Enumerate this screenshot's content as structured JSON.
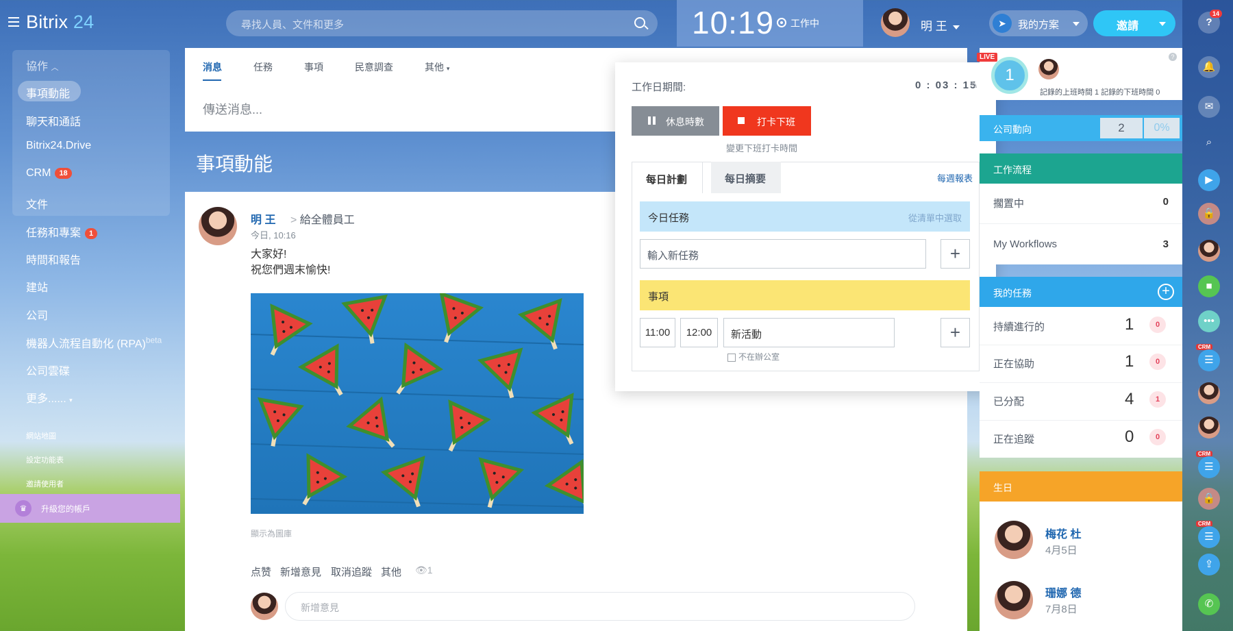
{
  "header": {
    "logo_main": "Bitrix",
    "logo_num": "24",
    "search_placeholder": "尋找人員、文件和更多",
    "clock": "10:19",
    "status": "工作中",
    "user_name": "明 王",
    "plan_label": "我的方案",
    "invite_label": "邀請"
  },
  "left_menu": {
    "section": "協作",
    "items": [
      {
        "label": "事項動能"
      },
      {
        "label": "聊天和通話"
      },
      {
        "label": "Bitrix24.Drive"
      },
      {
        "label": "CRM",
        "badge": "18"
      },
      {
        "label": "文件"
      },
      {
        "label": "任務和專案",
        "badge": "1"
      },
      {
        "label": "時間和報告"
      },
      {
        "label": "建站"
      },
      {
        "label": "公司"
      },
      {
        "label": "機器人流程自動化 (RPA)",
        "sup": "beta"
      },
      {
        "label": "公司雲碟"
      },
      {
        "label": "更多......"
      }
    ],
    "links": [
      "網站地圖",
      "設定功能表",
      "邀請使用者"
    ],
    "upgrade": "升級您的帳戶"
  },
  "feed": {
    "tabs": [
      "消息",
      "任務",
      "事項",
      "民意調查",
      "其他"
    ],
    "send_placeholder": "傳送消息...",
    "title": "事項動能",
    "post": {
      "author": "明 王",
      "to": "給全體員工",
      "time": "今日, 10:16",
      "line1": "大家好!",
      "line2": "祝您們週末愉快!",
      "show_gallery": "顯示為圖庫",
      "actions": [
        "点赞",
        "新增意見",
        "取消追蹤",
        "其他"
      ],
      "views": "1",
      "comment_placeholder": "新增意見"
    }
  },
  "popup": {
    "work_label": "工作日期間:",
    "work_time": "0 : 03 : 15",
    "pause": "休息時數",
    "clock_out": "打卡下班",
    "change_time": "變更下班打卡時間",
    "tab_plan": "每日計劃",
    "tab_summary": "每日摘要",
    "weekly": "每週報表",
    "today_tasks": "今日任務",
    "choose_list": "從清單中選取",
    "new_task_placeholder": "輸入新任務",
    "events": "事項",
    "time_from": "11:00",
    "time_to": "12:00",
    "new_event": "新活動",
    "not_in_office": "不在辦公室"
  },
  "right": {
    "live": "LIVE",
    "live_count": "1",
    "live_text": "記錄的上班時間 1   記錄的下班時間 0",
    "company_label": "公司動向",
    "company_value": "2",
    "company_pct": "0%",
    "workflow_head": "工作流程",
    "workflow_rows": [
      {
        "label": "擱置中",
        "count": "0"
      },
      {
        "label": "My Workflows",
        "count": "3"
      }
    ],
    "mytask_head": "我的任務",
    "tasks": [
      {
        "label": "持續進行的",
        "num": "1",
        "badge": "0"
      },
      {
        "label": "正在協助",
        "num": "1",
        "badge": "0"
      },
      {
        "label": "已分配",
        "num": "4",
        "badge": "1"
      },
      {
        "label": "正在追蹤",
        "num": "0",
        "badge": "0"
      }
    ],
    "birthday_head": "生日",
    "birthdays": [
      {
        "name": "梅花 杜",
        "date": "4月5日"
      },
      {
        "name": "珊娜 德",
        "date": "7月8日"
      }
    ]
  },
  "rail": {
    "help_badge": "14",
    "crm_tag": "CRM"
  }
}
